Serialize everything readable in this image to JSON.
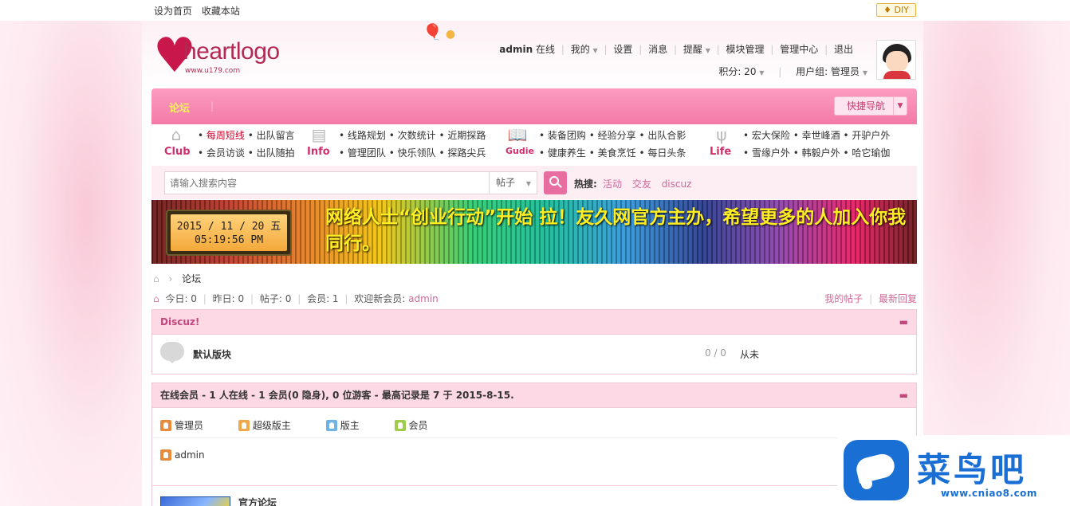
{
  "topbar": {
    "set_home": "设为首页",
    "bookmark": "收藏本站",
    "diy": "DIY"
  },
  "header": {
    "logo_word": "heartlogo",
    "logo_url": "www.u179.com",
    "user": {
      "name": "admin",
      "status": "在线",
      "links": [
        "我的",
        "设置",
        "消息",
        "提醒",
        "模块管理",
        "管理中心",
        "退出"
      ],
      "points_label": "积分: 20",
      "group_label": "用户组: 管理员"
    }
  },
  "nav": {
    "forum": "论坛",
    "quick_nav": "快捷导航"
  },
  "categories": [
    {
      "label": "Club",
      "links": [
        "每周短线",
        "出队留言",
        "会员访谈",
        "出队随拍"
      ]
    },
    {
      "label": "Info",
      "links": [
        "线路规划",
        "次数统计",
        "近期探路",
        "管理团队",
        "快乐领队",
        "探路尖兵"
      ]
    },
    {
      "label": "Gudie",
      "links": [
        "装备团购",
        "经验分享",
        "出队合影",
        "健康养生",
        "美食烹饪",
        "每日头条"
      ]
    },
    {
      "label": "Life",
      "links": [
        "宏大保险",
        "幸世峰酒",
        "开驴户外",
        "雪缘户外",
        "韩毅户外",
        "哈它瑜伽"
      ]
    }
  ],
  "search": {
    "placeholder": "请输入搜索内容",
    "type": "帖子",
    "hot_label": "热搜:",
    "hot_words": [
      "活动",
      "交友",
      "discuz"
    ]
  },
  "banner": {
    "date": "2015 / 11 / 20  五",
    "time": "05:19:56  PM",
    "text": "网络人士“创业行动”开始 拉！友久网官方主办，希望更多的人加入你我同行。"
  },
  "breadcrumb": {
    "current": "论坛"
  },
  "stats": {
    "today": "今日: 0",
    "yesterday": "昨日: 0",
    "posts": "帖子: 0",
    "members": "会员: 1",
    "welcome": "欢迎新会员:",
    "new_member": "admin",
    "my_posts": "我的帖子",
    "new_replies": "最新回复"
  },
  "section": {
    "title": "Discuz!",
    "forum_name": "默认版块",
    "forum_counts": "0 / 0",
    "forum_last": "从未"
  },
  "online": {
    "title": "在线会员 - 1 人在线 - 1 会员(0 隐身), 0 位游客 - 最高记录是 7 于 2015-8-15.",
    "legend": [
      "管理员",
      "超级版主",
      "版主",
      "会员"
    ],
    "legend_colors": [
      "#e88a3a",
      "#f0a94a",
      "#6cb3e6",
      "#9fcd4a"
    ],
    "users": [
      "admin"
    ]
  },
  "official": {
    "title": "官方论坛"
  },
  "watermark": {
    "title": "菜鸟吧",
    "url": "www.cniao8.com"
  }
}
